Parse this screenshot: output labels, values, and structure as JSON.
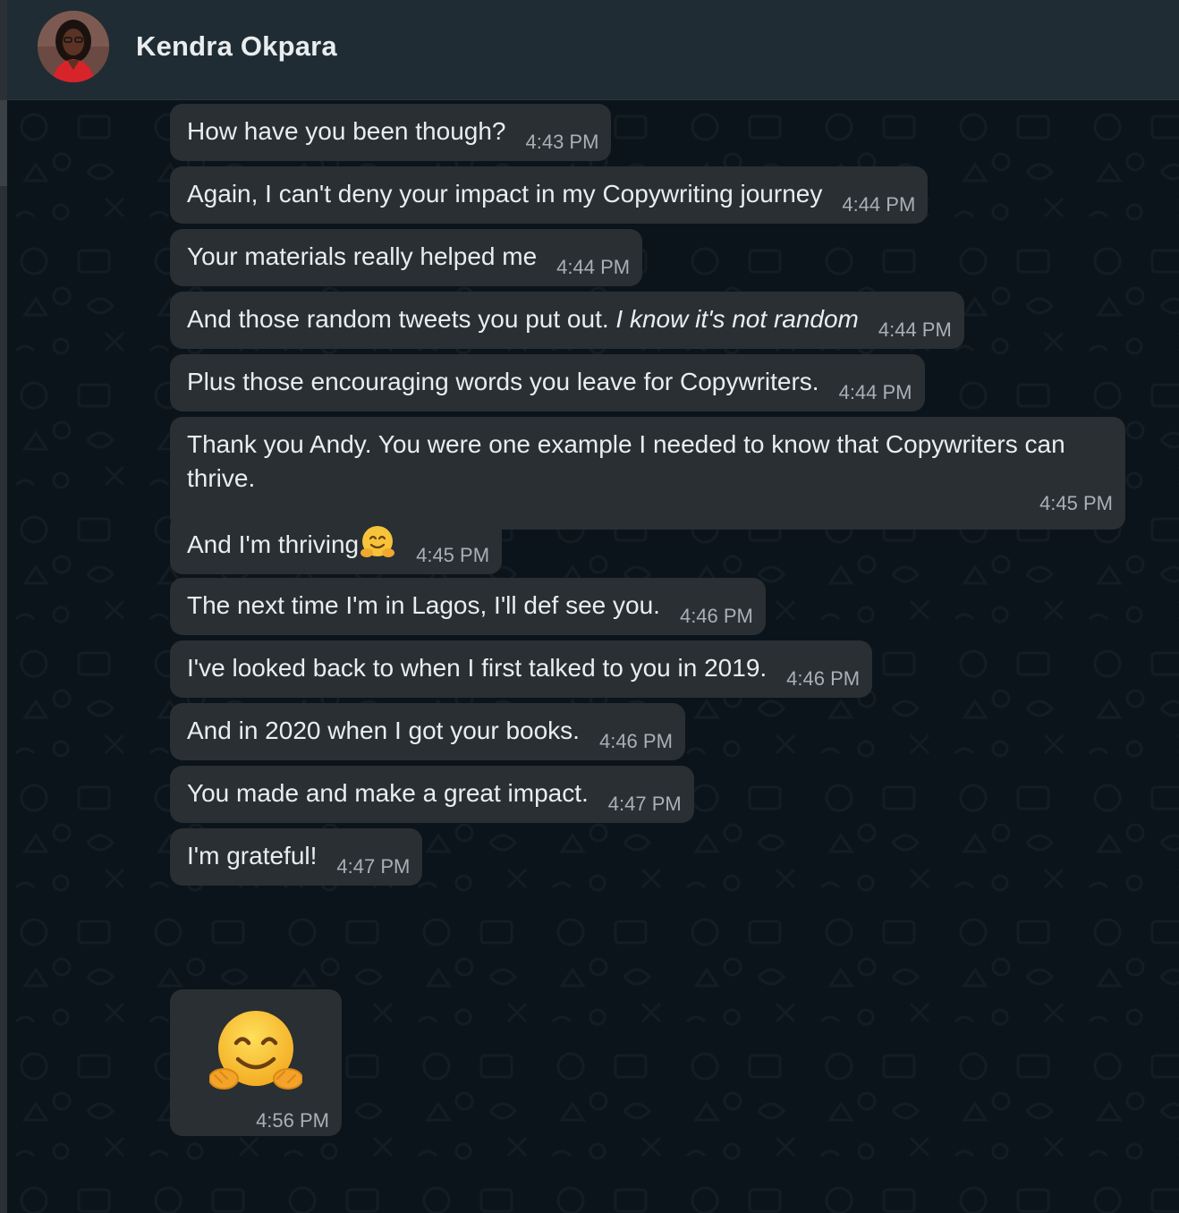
{
  "contact": {
    "name": "Kendra Okpara"
  },
  "messages": [
    {
      "text": "How have you been though?",
      "time": "4:43 PM"
    },
    {
      "text": "Again, I can't deny your impact in my Copywriting journey",
      "time": "4:44 PM"
    },
    {
      "text": "Your materials really helped me",
      "time": "4:44 PM"
    },
    {
      "text": "And those random tweets you put out.",
      "italic": "I know it's not random",
      "time": "4:44 PM"
    },
    {
      "text": "Plus those encouraging words you leave for Copywriters.",
      "time": "4:44 PM"
    },
    {
      "text": "Thank you Andy. You were one example I needed to know that Copywriters can thrive.",
      "time": "4:45 PM"
    },
    {
      "text": "And I'm thriving",
      "time": "4:45 PM"
    },
    {
      "text": "The next time I'm in Lagos, I'll def see you.",
      "time": "4:46 PM"
    },
    {
      "text": "I've looked back to when I first talked to you in 2019.",
      "time": "4:46 PM"
    },
    {
      "text": "And in 2020 when I got your books.",
      "time": "4:46 PM"
    },
    {
      "text": "You made and make a great impact.",
      "time": "4:47 PM"
    },
    {
      "text": "I'm grateful!",
      "time": "4:47 PM"
    }
  ],
  "emoji_message": {
    "icon": "hugging-face-emoji",
    "time": "4:56 PM"
  },
  "colors": {
    "header_bg": "#202c33",
    "chat_bg": "#0b141a",
    "bubble_bg": "#2a2f33",
    "text": "#e9edef",
    "timestamp": "#a9b0b5"
  }
}
